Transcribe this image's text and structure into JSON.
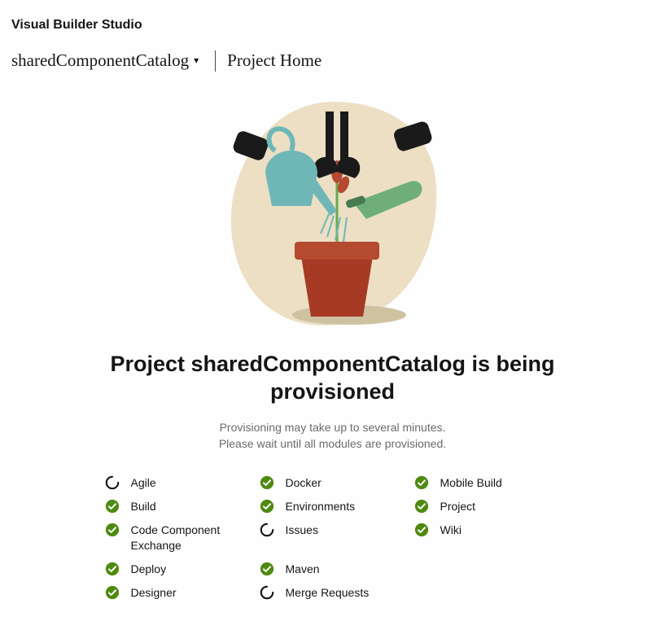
{
  "app_title": "Visual Builder Studio",
  "breadcrumb": {
    "project_name": "sharedComponentCatalog",
    "current": "Project Home"
  },
  "provisioning": {
    "heading": "Project sharedComponentCatalog is being provisioned",
    "subline1": "Provisioning may take up to several minutes.",
    "subline2": "Please wait until all modules are provisioned."
  },
  "modules": [
    {
      "label": "Agile",
      "status": "loading"
    },
    {
      "label": "Build",
      "status": "done"
    },
    {
      "label": "Code Component Exchange",
      "status": "done"
    },
    {
      "label": "Deploy",
      "status": "done"
    },
    {
      "label": "Designer",
      "status": "done"
    },
    {
      "label": "Docker",
      "status": "done"
    },
    {
      "label": "Environments",
      "status": "done"
    },
    {
      "label": "Issues",
      "status": "loading"
    },
    {
      "label": "Maven",
      "status": "done"
    },
    {
      "label": "Merge Requests",
      "status": "loading"
    },
    {
      "label": "Mobile Build",
      "status": "done"
    },
    {
      "label": "Project",
      "status": "done"
    },
    {
      "label": "Wiki",
      "status": "done"
    }
  ],
  "colors": {
    "done": "#4f8a10",
    "loading": "#161513"
  }
}
